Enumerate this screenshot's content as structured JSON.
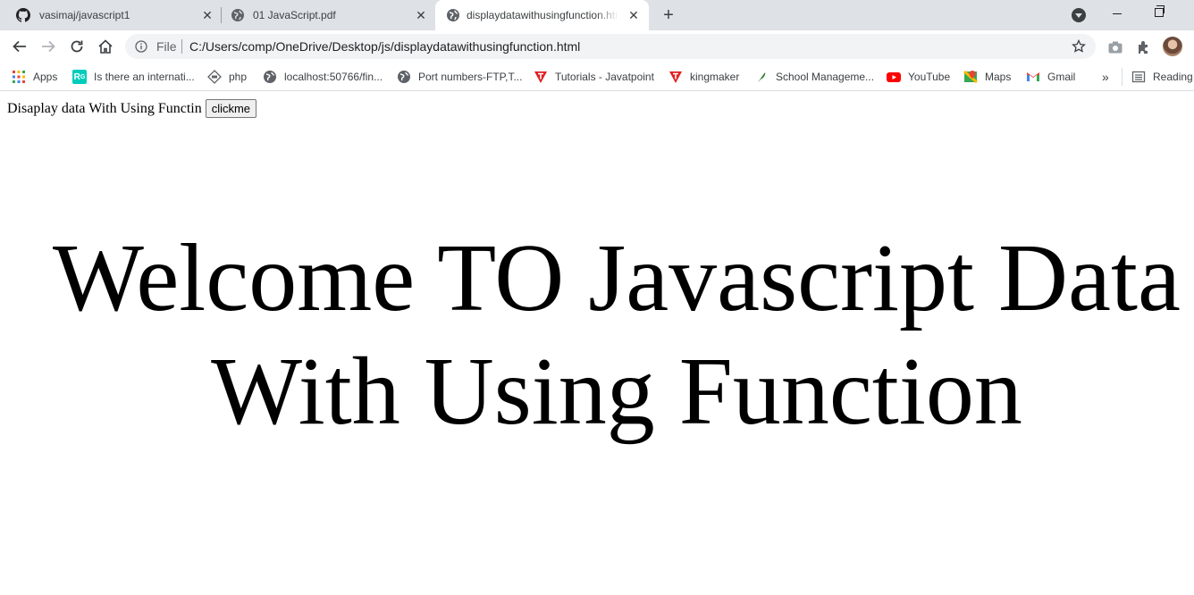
{
  "tabs": [
    {
      "title": "vasimaj/javascript1",
      "icon": "github-icon"
    },
    {
      "title": "01 JavaScript.pdf",
      "icon": "globe-icon"
    },
    {
      "title": "displaydatawithusingfunction.html",
      "icon": "globe-icon",
      "active": true
    }
  ],
  "omnibox": {
    "scheme_label": "File",
    "url": "C:/Users/comp/OneDrive/Desktop/js/displaydatawithusingfunction.html"
  },
  "bookmarks": [
    {
      "label": "Apps",
      "icon": "apps-grid-icon"
    },
    {
      "label": "Is there an internati...",
      "icon": "researchgate-icon"
    },
    {
      "label": "php",
      "icon": "php-icon"
    },
    {
      "label": "localhost:50766/fin...",
      "icon": "globe-icon"
    },
    {
      "label": "Port numbers-FTP,T...",
      "icon": "globe-icon"
    },
    {
      "label": "Tutorials - Javatpoint",
      "icon": "javatpoint-icon"
    },
    {
      "label": "kingmaker",
      "icon": "javatpoint-icon"
    },
    {
      "label": "School Manageme...",
      "icon": "feather-icon"
    },
    {
      "label": "YouTube",
      "icon": "youtube-icon"
    },
    {
      "label": "Maps",
      "icon": "maps-icon"
    },
    {
      "label": "Gmail",
      "icon": "gmail-icon"
    },
    {
      "label": "Reading",
      "icon": "reading-list-icon"
    }
  ],
  "page": {
    "intro_text": "Disaplay data With Using Functin",
    "button_label": "clickme",
    "heading": "Welcome TO Javascript Data With Using Function"
  },
  "colors": {
    "tabstrip": "#dee1e6",
    "omnibox": "#f1f3f4",
    "text": "#3c4043"
  }
}
